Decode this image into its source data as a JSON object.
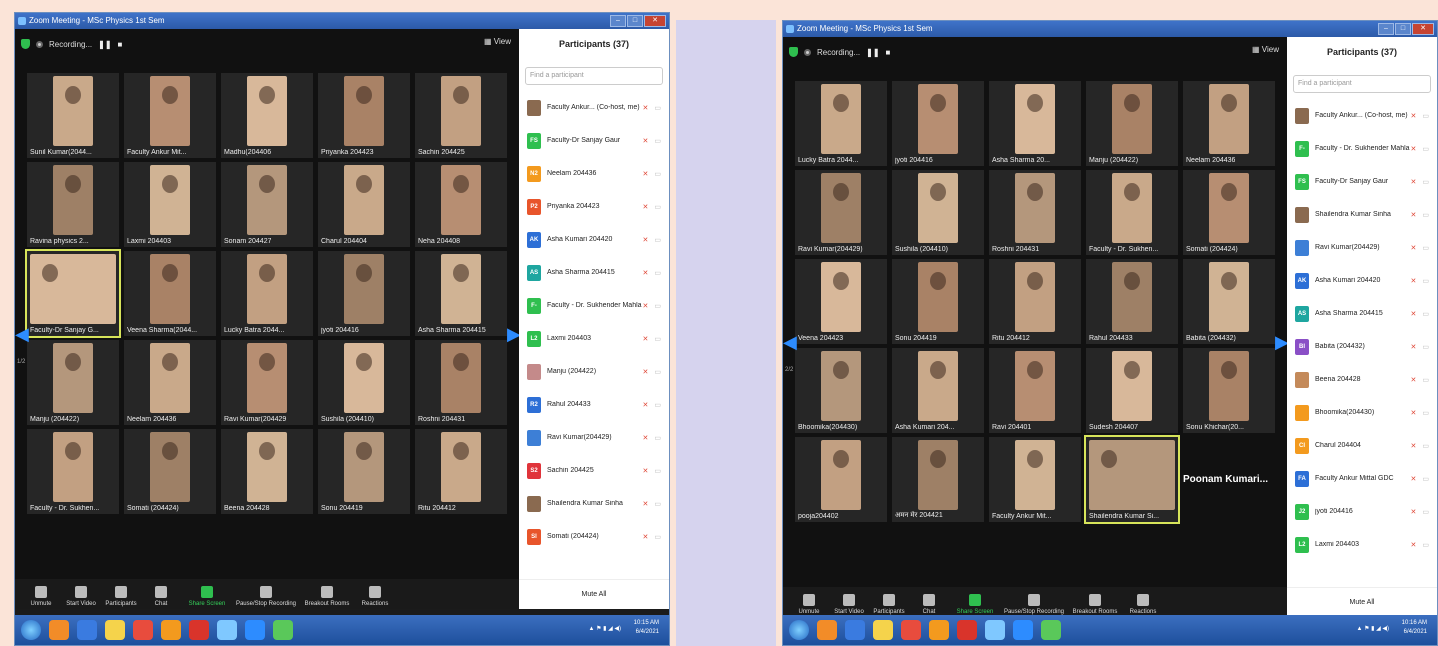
{
  "windows": [
    {
      "title": "Zoom Meeting - MSc Physics 1st Sem",
      "recording_label": "Recording...",
      "view_label": "View",
      "page_indicator": "1/2",
      "tiles": [
        {
          "name": "Sunil Kumar(2044..."
        },
        {
          "name": "Faculty Ankur Mit..."
        },
        {
          "name": "Madhu(204406"
        },
        {
          "name": "Priyanka 204423"
        },
        {
          "name": "Sachin 204425"
        },
        {
          "name": "Ravina physics 2..."
        },
        {
          "name": "Laxmi 204403"
        },
        {
          "name": "Sonam 204427"
        },
        {
          "name": "Charul 204404"
        },
        {
          "name": "Neha 204408"
        },
        {
          "name": "Faculty-Dr Sanjay G...",
          "active": true
        },
        {
          "name": "Veena Sharma(2044..."
        },
        {
          "name": "Lucky Batra 2044..."
        },
        {
          "name": "jyoti 204416"
        },
        {
          "name": "Asha Sharma 204415"
        },
        {
          "name": "Manju (204422)"
        },
        {
          "name": "Neelam 204436"
        },
        {
          "name": "Ravi Kumar(204429"
        },
        {
          "name": "Sushila (204410)"
        },
        {
          "name": "Roshni 204431"
        },
        {
          "name": "Faculty - Dr. Sukhen..."
        },
        {
          "name": "Somati (204424)"
        },
        {
          "name": "Beena 204428"
        },
        {
          "name": "Sonu 204419"
        },
        {
          "name": "Ritu 204412"
        }
      ],
      "toolbar": [
        {
          "label": "Unmute"
        },
        {
          "label": "Start Video"
        },
        {
          "label": "Participants",
          "count": "37"
        },
        {
          "label": "Chat"
        },
        {
          "label": "Share Screen"
        },
        {
          "label": "Pause/Stop Recording"
        },
        {
          "label": "Breakout Rooms"
        },
        {
          "label": "Reactions"
        }
      ],
      "leave_label": "Leave Room",
      "participants_title": "Participants (37)",
      "search_placeholder": "Find a participant",
      "participants": [
        {
          "initials": "",
          "name": "Faculty Ankur... (Co-host, me)",
          "color": "#8a6a50"
        },
        {
          "initials": "FS",
          "name": "Faculty-Dr Sanjay Gaur",
          "color": "#2fbf4f"
        },
        {
          "initials": "N2",
          "name": "Neelam 204436",
          "color": "#f39a1e"
        },
        {
          "initials": "P2",
          "name": "Priyanka 204423",
          "color": "#e8552b"
        },
        {
          "initials": "AK",
          "name": "Asha Kumari 204420",
          "color": "#2d6fd6"
        },
        {
          "initials": "AS",
          "name": "Asha Sharma 204415",
          "color": "#1fa6a0"
        },
        {
          "initials": "F-",
          "name": "Faculty - Dr. Sukhender Mahla ...",
          "color": "#2fbf4f"
        },
        {
          "initials": "L2",
          "name": "Laxmi 204403",
          "color": "#2fbf4f"
        },
        {
          "initials": "",
          "name": "Manju (204422)",
          "color": "#c48a8a"
        },
        {
          "initials": "R2",
          "name": "Rahul 204433",
          "color": "#2d6fd6"
        },
        {
          "initials": "",
          "name": "Ravi Kumar(204429)",
          "color": "#3d7fd6"
        },
        {
          "initials": "S2",
          "name": "Sachin 204425",
          "color": "#e0343b"
        },
        {
          "initials": "",
          "name": "Shailendra Kumar Sinha",
          "color": "#8a6a50"
        },
        {
          "initials": "SI",
          "name": "Somati (204424)",
          "color": "#e8552b"
        }
      ],
      "mute_all": "Mute All",
      "clock_time": "10:15 AM",
      "clock_date": "6/4/2021"
    },
    {
      "title": "Zoom Meeting - MSc Physics 1st Sem",
      "recording_label": "Recording...",
      "view_label": "View",
      "page_indicator": "2/2",
      "tiles": [
        {
          "name": "Lucky Batra 2044..."
        },
        {
          "name": "jyoti 204416"
        },
        {
          "name": "Asha Sharma 20..."
        },
        {
          "name": "Manju (204422)"
        },
        {
          "name": "Neelam 204436"
        },
        {
          "name": "Ravi Kumar(204429)"
        },
        {
          "name": "Sushila (204410)"
        },
        {
          "name": "Roshni 204431"
        },
        {
          "name": "Faculty - Dr. Sukhen..."
        },
        {
          "name": "Somati (204424)"
        },
        {
          "name": "Veena 204423"
        },
        {
          "name": "Sonu 204419"
        },
        {
          "name": "Ritu 204412"
        },
        {
          "name": "Rahul 204433"
        },
        {
          "name": "Babita (204432)"
        },
        {
          "name": "Bhoomika(204430)"
        },
        {
          "name": "Asha Kumari 204..."
        },
        {
          "name": "Ravi 204401"
        },
        {
          "name": "Sudesh 204407"
        },
        {
          "name": "Sonu Khichar(20..."
        },
        {
          "name": "pooja204402"
        },
        {
          "name": "अमन मेर 204421"
        },
        {
          "name": "Faculty Ankur Mit..."
        },
        {
          "name": "Shailendra Kumar Si...",
          "active": true
        },
        {
          "name": "Poonam Kumari...",
          "name_only": true
        }
      ],
      "toolbar": [
        {
          "label": "Unmute"
        },
        {
          "label": "Start Video"
        },
        {
          "label": "Participants",
          "count": "37"
        },
        {
          "label": "Chat"
        },
        {
          "label": "Share Screen"
        },
        {
          "label": "Pause/Stop Recording"
        },
        {
          "label": "Breakout Rooms"
        },
        {
          "label": "Reactions"
        }
      ],
      "leave_label": "Leave Room",
      "participants_title": "Participants (37)",
      "search_placeholder": "Find a participant",
      "participants": [
        {
          "initials": "",
          "name": "Faculty Ankur... (Co-host, me)",
          "color": "#8a6a50"
        },
        {
          "initials": "F-",
          "name": "Faculty - Dr. Sukhender Mahla ...",
          "color": "#2fbf4f"
        },
        {
          "initials": "FS",
          "name": "Faculty-Dr Sanjay Gaur",
          "color": "#2fbf4f"
        },
        {
          "initials": "",
          "name": "Shailendra Kumar Sinha",
          "color": "#8a6a50"
        },
        {
          "initials": "",
          "name": "Ravi Kumar(204429)",
          "color": "#3d7fd6"
        },
        {
          "initials": "AK",
          "name": "Asha Kumari 204420",
          "color": "#2d6fd6"
        },
        {
          "initials": "AS",
          "name": "Asha Sharma 204415",
          "color": "#1fa6a0"
        },
        {
          "initials": "BI",
          "name": "Babita (204432)",
          "color": "#8a4fc6"
        },
        {
          "initials": "",
          "name": "Beena 204428",
          "color": "#c48a5a"
        },
        {
          "initials": "",
          "name": "Bhoomika(204430)",
          "color": "#f39a1e"
        },
        {
          "initials": "CI",
          "name": "Charul 204404",
          "color": "#f39a1e"
        },
        {
          "initials": "FA",
          "name": "Faculty Ankur Mittal GDC",
          "color": "#2d6fd6"
        },
        {
          "initials": "J2",
          "name": "jyoti 204416",
          "color": "#2fbf4f"
        },
        {
          "initials": "L2",
          "name": "Laxmi 204403",
          "color": "#2fbf4f"
        }
      ],
      "mute_all": "Mute All",
      "clock_time": "10:16 AM",
      "clock_date": "6/4/2021"
    }
  ]
}
